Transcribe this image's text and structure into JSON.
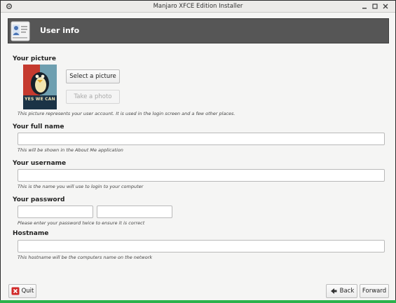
{
  "window": {
    "title": "Manjaro XFCE Edition Installer"
  },
  "header": {
    "title": "User info"
  },
  "picture": {
    "section_label": "Your picture",
    "select_button": "Select a picture",
    "take_photo_button": "Take a photo",
    "hint": "This picture represents your user account. It is used in the login screen and a few other places.",
    "image_caption": "YES WE CAN"
  },
  "fullname": {
    "label": "Your full name",
    "value": "",
    "hint": "This will be shown in the About Me application"
  },
  "username": {
    "label": "Your username",
    "value": "",
    "hint": "This is the name you will use to login to your computer"
  },
  "password": {
    "label": "Your password",
    "value": "",
    "confirm_value": "",
    "hint": "Please enter your password twice to ensure it is correct"
  },
  "hostname": {
    "label": "Hostname",
    "value": "",
    "hint": "This hostname will be the computers name on the network"
  },
  "footer": {
    "quit_label": "Quit",
    "back_label": "Back",
    "forward_label": "Forward"
  },
  "colors": {
    "header_bg": "#565656",
    "accent_green": "#2bb24c",
    "quit_red": "#d12a2a"
  },
  "icons": {
    "window_menu": "gear-icon",
    "header": "user-id-card-icon",
    "quit": "close-x-icon",
    "back": "arrow-left-icon"
  }
}
